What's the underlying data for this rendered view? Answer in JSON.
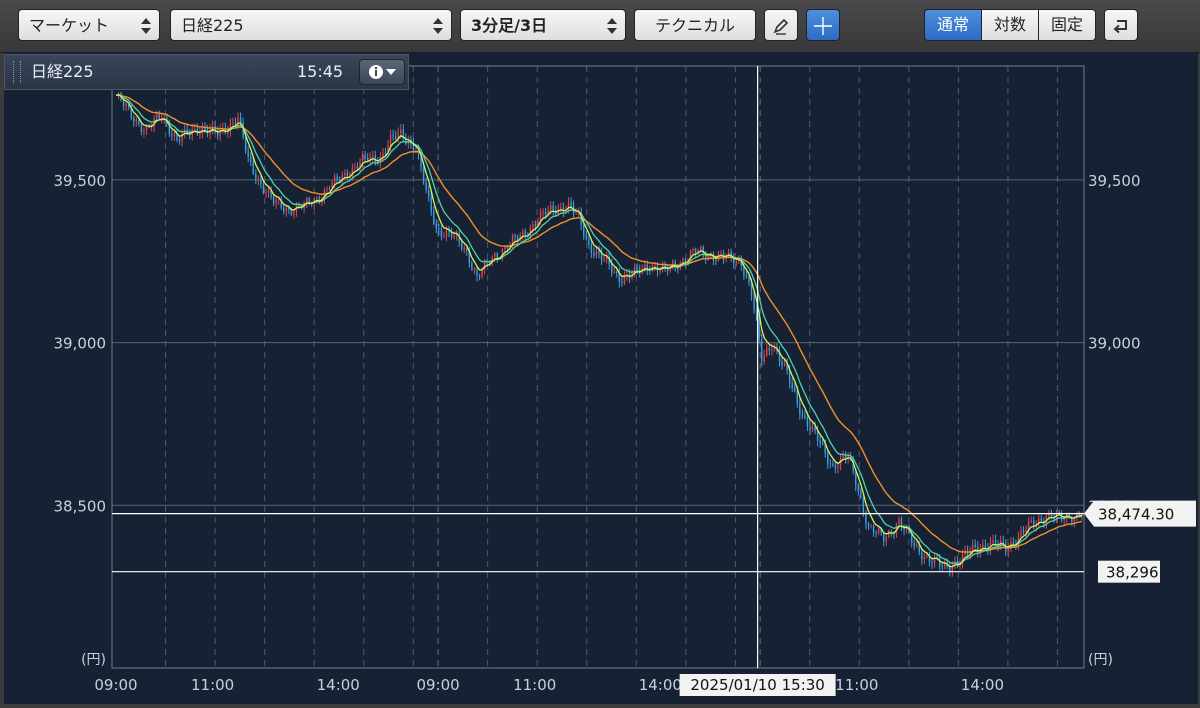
{
  "toolbar": {
    "market_select": "マーケット",
    "symbol_select": "日経225",
    "interval_select": "3分足/3日",
    "technical_button": "テクニカル",
    "scale_modes": [
      "通常",
      "対数",
      "固定"
    ],
    "active_scale_mode": "通常"
  },
  "info": {
    "symbol": "日経225",
    "time": "15:45"
  },
  "chart_data": {
    "type": "candlestick",
    "y_ticks": [
      "39,500",
      "39,000",
      "38,500"
    ],
    "y_unit": "(円)",
    "x_ticks": [
      "09:00",
      "11:00",
      "14:00",
      "09:00",
      "11:00",
      "14:00",
      "11:00",
      "14:00"
    ],
    "ylim": [
      38000,
      39850
    ],
    "crosshair": {
      "label": "2025/01/10 15:30",
      "price": "38,296"
    },
    "last_price": "38,474.30",
    "grid": true,
    "days": 3,
    "close_path": [
      [
        0,
        39760
      ],
      [
        6,
        39700
      ],
      [
        12,
        39650
      ],
      [
        18,
        39700
      ],
      [
        24,
        39620
      ],
      [
        32,
        39660
      ],
      [
        40,
        39640
      ],
      [
        48,
        39690
      ],
      [
        52,
        39560
      ],
      [
        56,
        39500
      ],
      [
        62,
        39430
      ],
      [
        68,
        39410
      ],
      [
        74,
        39420
      ],
      [
        80,
        39450
      ],
      [
        86,
        39490
      ],
      [
        92,
        39530
      ],
      [
        98,
        39560
      ],
      [
        104,
        39570
      ],
      [
        108,
        39620
      ],
      [
        112,
        39640
      ],
      [
        118,
        39600
      ],
      [
        122,
        39460
      ],
      [
        126,
        39350
      ],
      [
        132,
        39330
      ],
      [
        138,
        39280
      ],
      [
        142,
        39200
      ],
      [
        148,
        39260
      ],
      [
        154,
        39300
      ],
      [
        160,
        39330
      ],
      [
        166,
        39380
      ],
      [
        172,
        39410
      ],
      [
        178,
        39420
      ],
      [
        182,
        39380
      ],
      [
        186,
        39300
      ],
      [
        192,
        39250
      ],
      [
        198,
        39200
      ],
      [
        204,
        39210
      ],
      [
        210,
        39240
      ],
      [
        216,
        39220
      ],
      [
        222,
        39250
      ],
      [
        228,
        39280
      ],
      [
        234,
        39270
      ],
      [
        240,
        39260
      ],
      [
        246,
        39250
      ],
      [
        250,
        39150
      ],
      [
        254,
        38950
      ],
      [
        258,
        39000
      ],
      [
        264,
        38900
      ],
      [
        270,
        38780
      ],
      [
        276,
        38700
      ],
      [
        282,
        38620
      ],
      [
        288,
        38650
      ],
      [
        292,
        38550
      ],
      [
        296,
        38430
      ],
      [
        302,
        38400
      ],
      [
        308,
        38450
      ],
      [
        314,
        38380
      ],
      [
        320,
        38330
      ],
      [
        326,
        38310
      ],
      [
        332,
        38330
      ],
      [
        338,
        38370
      ],
      [
        344,
        38380
      ],
      [
        350,
        38370
      ],
      [
        356,
        38410
      ],
      [
        360,
        38440
      ],
      [
        366,
        38470
      ],
      [
        372,
        38460
      ],
      [
        376,
        38470
      ],
      [
        380,
        38474
      ]
    ],
    "ma_fast_label": "",
    "ma_slow_label": ""
  },
  "colors": {
    "up": "#e0424f",
    "down": "#3e9ee0",
    "ma_fast": "#d6f25a",
    "ma_mid": "#4fd3a8",
    "ma_slow": "#f0902c",
    "grid": "#6f7f94",
    "background": "#162234",
    "accent": "#2c6bc2"
  }
}
